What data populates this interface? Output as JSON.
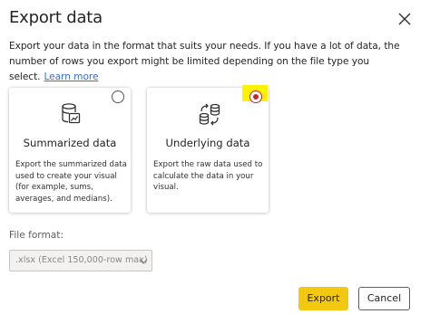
{
  "dialog": {
    "title": "Export data",
    "description": "Export your data in the format that suits your needs. If you have a lot of data, the number of rows you export might be limited depending on the file type you select.",
    "learn_more": "Learn more"
  },
  "options": [
    {
      "title": "Summarized data",
      "description": "Export the summarized data used to create your visual (for example, sums, averages, and medians).",
      "selected": false,
      "icon": "database-chart-icon"
    },
    {
      "title": "Underlying data",
      "description": "Export the raw data used to calculate the data in your visual.",
      "selected": true,
      "icon": "database-sync-icon"
    }
  ],
  "file_format": {
    "label": "File format:",
    "value": ".xlsx (Excel 150,000-row max)"
  },
  "buttons": {
    "export": "Export",
    "cancel": "Cancel"
  },
  "colors": {
    "accent": "#f2c811",
    "selected_radio": "#c1272d",
    "highlight": "#fff200",
    "link": "#3a6bd0"
  }
}
